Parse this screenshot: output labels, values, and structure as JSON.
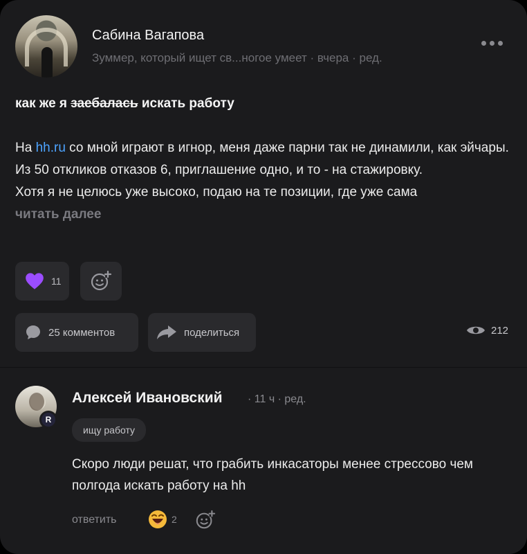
{
  "post": {
    "author": "Сабина Вагапова",
    "meta": "Зуммер, который ищет св...ногое умеет · вчера · ред.",
    "title_pre": "как же я ",
    "title_strike": "заебалась",
    "title_post": " искать работу",
    "body": {
      "p1_pre": "На ",
      "link": "hh.ru",
      "p1_post": " со мной играют в игнор, меня даже парни так не динамили, как эйчары.",
      "p2": "Из 50 откликов отказов 6, приглашение одно, и то - на стажировку.",
      "p3": "Хотя я не целюсь уже высоко, подаю на те позиции, где уже сама",
      "read_more": "читать далее"
    },
    "reactions": {
      "heart_count": "11"
    },
    "actions": {
      "comments_label": "25 комментов",
      "share_label": "поделиться"
    },
    "views": "212"
  },
  "comment": {
    "author": "Алексей Ивановский",
    "meta": "· 11 ч · ред.",
    "badge": "R",
    "tag": "ищу работу",
    "text": "Скоро люди решат, что грабить инкасаторы менее стрессово чем полгода искать работу на hh",
    "reply_label": "ответить",
    "reaction_count": "2"
  },
  "colors": {
    "background": "#1b1b1d",
    "link": "#4da3ff",
    "heart": "#9b4dff",
    "chip": "#2a2a2d"
  }
}
